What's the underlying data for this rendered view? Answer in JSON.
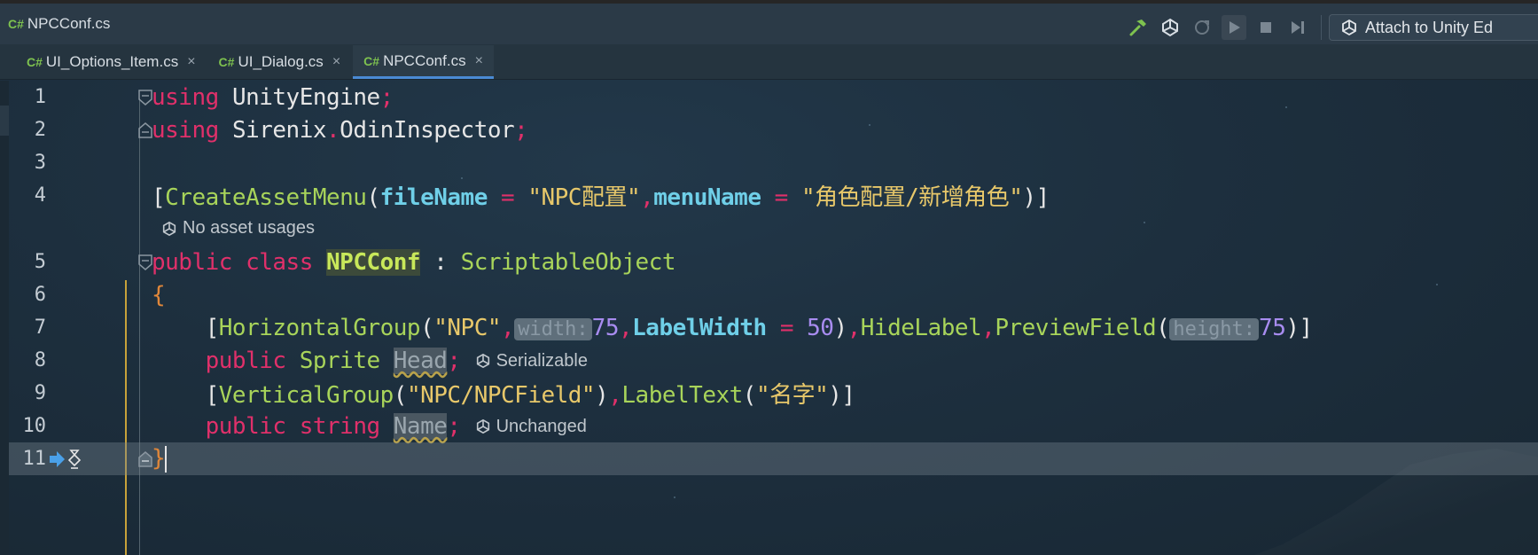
{
  "titlebar": {
    "file_badge": "C#",
    "file_title": "NPCConf.cs",
    "attach_label": "Attach to Unity Ed",
    "icons": [
      "hammer-icon",
      "unity-icon",
      "reload-icon",
      "play-icon",
      "stop-icon",
      "step-icon",
      "unity-attach-icon"
    ]
  },
  "tabs": [
    {
      "badge": "C#",
      "label": "UI_Options_Item.cs",
      "close": "×",
      "active": false
    },
    {
      "badge": "C#",
      "label": "UI_Dialog.cs",
      "close": "×",
      "active": false
    },
    {
      "badge": "C#",
      "label": "NPCConf.cs",
      "close": "×",
      "active": true
    }
  ],
  "editor": {
    "line_numbers": [
      "1",
      "2",
      "3",
      "4",
      "5",
      "6",
      "7",
      "8",
      "9",
      "10",
      "11"
    ],
    "code": {
      "l1": {
        "kw": "using",
        "ns": "UnityEngine",
        "end": ";"
      },
      "l2": {
        "kw": "using",
        "ns1": "Sirenix",
        "dot": ".",
        "ns2": "OdinInspector",
        "end": ";"
      },
      "l4": {
        "open": "[",
        "attr": "CreateAssetMenu",
        "paren_open": "(",
        "arg1": "fileName",
        "eq1": " = ",
        "val1": "\"NPC配置\"",
        "comma": ",",
        "arg2": "menuName",
        "eq2": " = ",
        "val2": "\"角色配置/新增角色\"",
        "close": ")]"
      },
      "hint_usages": "No asset usages",
      "l5": {
        "kw1": "public",
        "kw2": "class",
        "cls": "NPCConf",
        "colon": " : ",
        "base": "ScriptableObject"
      },
      "l6": {
        "brace": "{"
      },
      "l7": {
        "open": "[",
        "attr1": "HorizontalGroup",
        "p1": "(",
        "s1": "\"NPC\"",
        "c1": ",",
        "hint1": "width:",
        "n1": "75",
        "c2": ",",
        "arg": "LabelWidth",
        "eq": " = ",
        "n2": "50",
        "p2": ")",
        "c3": ",",
        "attr2": "HideLabel",
        "c4": ",",
        "attr3": "PreviewField",
        "p3": "(",
        "hint2": "height:",
        "n3": "75",
        "close": ")]"
      },
      "l8": {
        "kw": "public",
        "type": "Sprite",
        "field": "Head",
        "end": ";",
        "hint": "Serializable"
      },
      "l9": {
        "open": "[",
        "attr1": "VerticalGroup",
        "p1": "(",
        "s1": "\"NPC/NPCField\"",
        "p2": ")",
        "c1": ",",
        "attr2": "LabelText",
        "p3": "(",
        "s2": "\"名字\"",
        "close": ")]"
      },
      "l10": {
        "kw1": "public",
        "kw2": "string",
        "field": "Name",
        "end": ";",
        "hint": "Unchanged"
      },
      "l11": {
        "brace": "}"
      }
    }
  },
  "colors": {
    "keyword": "#e0306a",
    "type": "#a8d45a",
    "string": "#e8c86a",
    "named_arg": "#6fcfe8",
    "number": "#a88cf0",
    "brace": "#e0873a",
    "tab_active_underline": "#4a8ad4"
  }
}
